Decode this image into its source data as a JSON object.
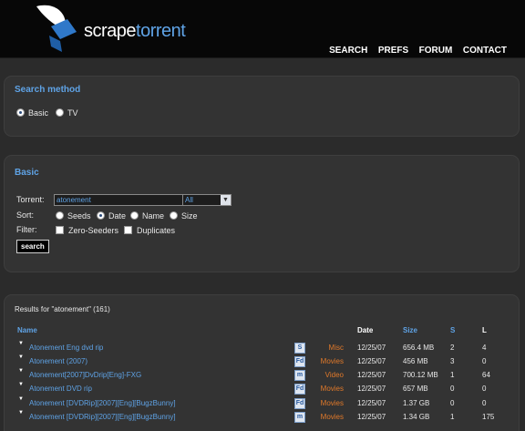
{
  "brand": {
    "part1": "scrape",
    "part2": "torrent"
  },
  "nav": [
    "SEARCH",
    "PREFS",
    "FORUM",
    "CONTACT"
  ],
  "method": {
    "title": "Search method",
    "options": [
      {
        "label": "Basic",
        "selected": true
      },
      {
        "label": "TV",
        "selected": false
      }
    ]
  },
  "basic": {
    "title": "Basic",
    "torrent_label": "Torrent:",
    "torrent_value": "atonement",
    "category_value": "All",
    "sort_label": "Sort:",
    "sort_options": [
      {
        "label": "Seeds",
        "selected": false
      },
      {
        "label": "Date",
        "selected": true
      },
      {
        "label": "Name",
        "selected": false
      },
      {
        "label": "Size",
        "selected": false
      }
    ],
    "filter_label": "Filter:",
    "filters": [
      "Zero-Seeders",
      "Duplicates"
    ],
    "search_button": "search"
  },
  "results": {
    "caption": "Results for \"atonement\" (161)",
    "headers": {
      "name": "Name",
      "date": "Date",
      "size": "Size",
      "s": "S",
      "l": "L"
    },
    "rows": [
      {
        "name": "Atonement Eng dvd rip",
        "icon": "S",
        "category": "Misc",
        "date": "12/25/07",
        "size": "656.4 MB",
        "s": "2",
        "l": "4"
      },
      {
        "name": "Atonement (2007)",
        "icon": "Fd",
        "category": "Movies",
        "date": "12/25/07",
        "size": "456 MB",
        "s": "3",
        "l": "0"
      },
      {
        "name": "Atonement[2007]DvDrip[Eng]-FXG",
        "icon": "m",
        "category": "Video",
        "date": "12/25/07",
        "size": "700.12 MB",
        "s": "1",
        "l": "64"
      },
      {
        "name": "Atonement DVD rip",
        "icon": "Fd",
        "category": "Movies",
        "date": "12/25/07",
        "size": "657 MB",
        "s": "0",
        "l": "0"
      },
      {
        "name": "Atonement [DVDRip][2007][Eng][BugzBunny]",
        "icon": "Fd",
        "category": "Movies",
        "date": "12/25/07",
        "size": "1.37 GB",
        "s": "0",
        "l": "0"
      },
      {
        "name": "Atonement [DVDRip][2007][Eng][BugzBunny]",
        "icon": "m",
        "category": "Movies",
        "date": "12/25/07",
        "size": "1.34 GB",
        "s": "1",
        "l": "175"
      }
    ]
  },
  "colors": {
    "accent": "#5fa3e6",
    "category": "#e0792a",
    "background": "#2b2b2b",
    "header": "#070707"
  }
}
